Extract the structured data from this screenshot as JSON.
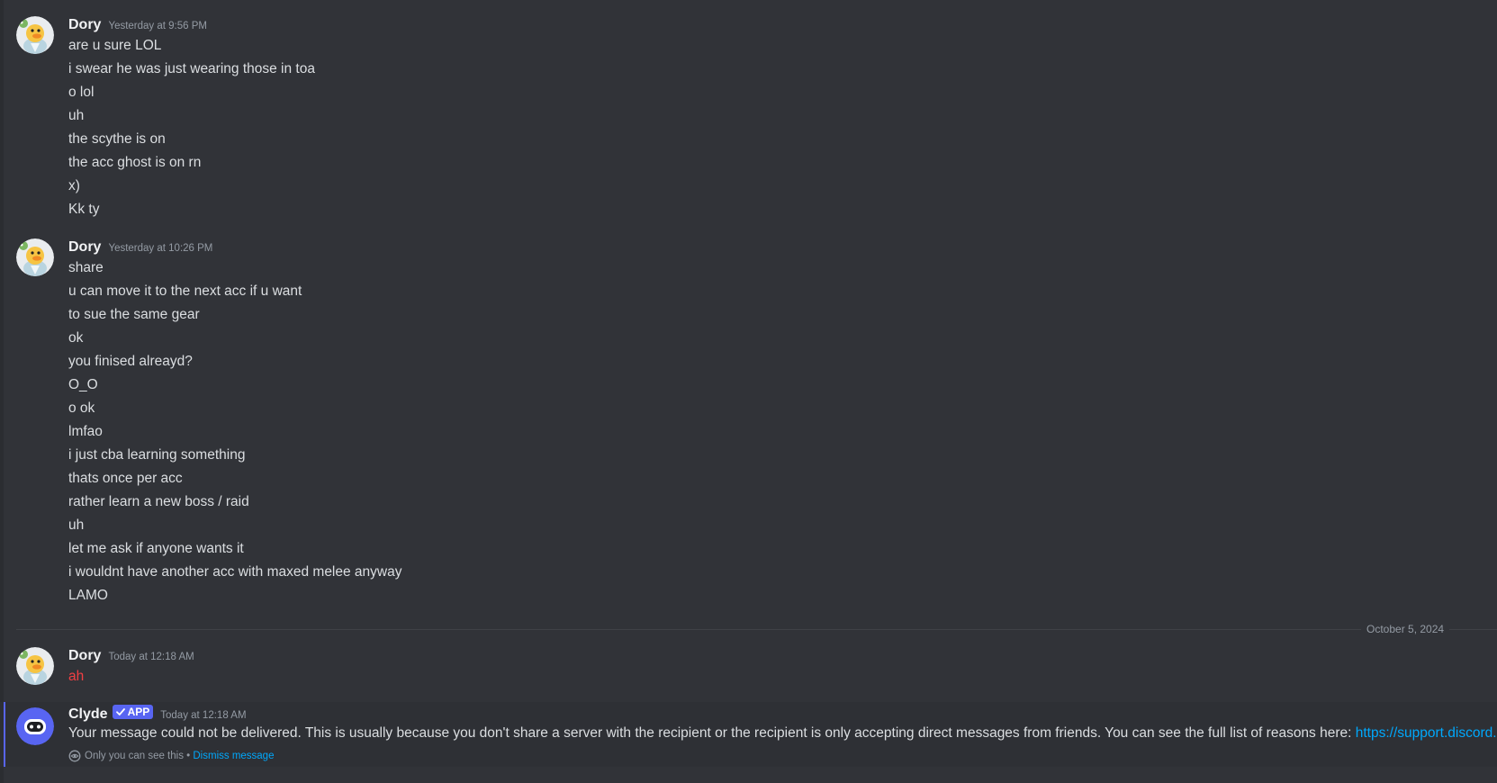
{
  "messages": [
    {
      "author": "Dory",
      "timestamp": "Yesterday at 9:56 PM",
      "avatar_icon": "duck-avatar-icon",
      "lines": [
        "are u sure LOL",
        "i swear he was just wearing those in toa",
        "o lol",
        "uh",
        "the scythe is on",
        "the acc ghost is on rn",
        "x)",
        "Kk ty"
      ]
    },
    {
      "author": "Dory",
      "timestamp": "Yesterday at 10:26 PM",
      "avatar_icon": "duck-avatar-icon",
      "lines": [
        "share",
        "u can move it to the next acc if u want",
        "to sue the same gear",
        "ok",
        "you finised alreayd?",
        "O_O",
        "o ok",
        "lmfao",
        "i just cba learning something",
        "thats once per acc",
        "rather learn a new boss / raid",
        "uh",
        "let me ask if anyone wants it",
        "i wouldnt have another acc with maxed melee anyway",
        "LAMO"
      ]
    },
    {
      "author": "Dory",
      "timestamp": "Today at 12:18 AM",
      "avatar_icon": "duck-avatar-icon",
      "lines": [
        "ah"
      ],
      "failed_color": "#f23f43"
    }
  ],
  "date_divider": "October 5, 2024",
  "system_message": {
    "author": "Clyde",
    "badge": "APP",
    "timestamp": "Today at 12:18 AM",
    "avatar_icon": "clyde-bot-icon",
    "text": "Your message could not be delivered. This is usually because you don't share a server with the recipient or the recipient is only accepting direct messages from friends. You can see the full list of reasons here: ",
    "link_text": "https://support.discord.com",
    "visibility_note": "Only you can see this",
    "separator": " • ",
    "dismiss_label": "Dismiss message"
  },
  "colors": {
    "background": "#313338",
    "accent": "#5865f2",
    "link": "#00a8fc",
    "error": "#f23f43"
  }
}
